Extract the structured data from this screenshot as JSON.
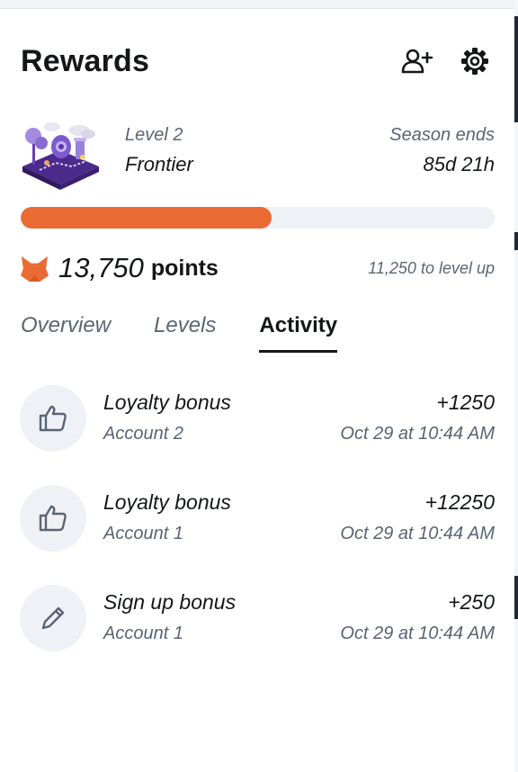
{
  "header": {
    "title": "Rewards",
    "add_user_icon": "person-plus-icon",
    "settings_icon": "gear-icon"
  },
  "level": {
    "label": "Level 2",
    "name": "Frontier",
    "season_label": "Season ends",
    "season_remaining": "85d 21h"
  },
  "progress": {
    "fraction": 0.53,
    "color": "#ea6a34"
  },
  "points": {
    "value": "13,750",
    "word": "points",
    "to_level": "11,250 to level up"
  },
  "tabs": [
    {
      "label": "Overview",
      "active": false
    },
    {
      "label": "Levels",
      "active": false
    },
    {
      "label": "Activity",
      "active": true
    }
  ],
  "activity": [
    {
      "icon": "thumbs-up-icon",
      "title": "Loyalty bonus",
      "account": "Account 2",
      "points": "+1250",
      "date": "Oct 29 at 10:44 AM"
    },
    {
      "icon": "thumbs-up-icon",
      "title": "Loyalty bonus",
      "account": "Account 1",
      "points": "+12250",
      "date": "Oct 29 at 10:44 AM"
    },
    {
      "icon": "pencil-icon",
      "title": "Sign up bonus",
      "account": "Account 1",
      "points": "+250",
      "date": "Oct 29 at 10:44 AM"
    }
  ]
}
